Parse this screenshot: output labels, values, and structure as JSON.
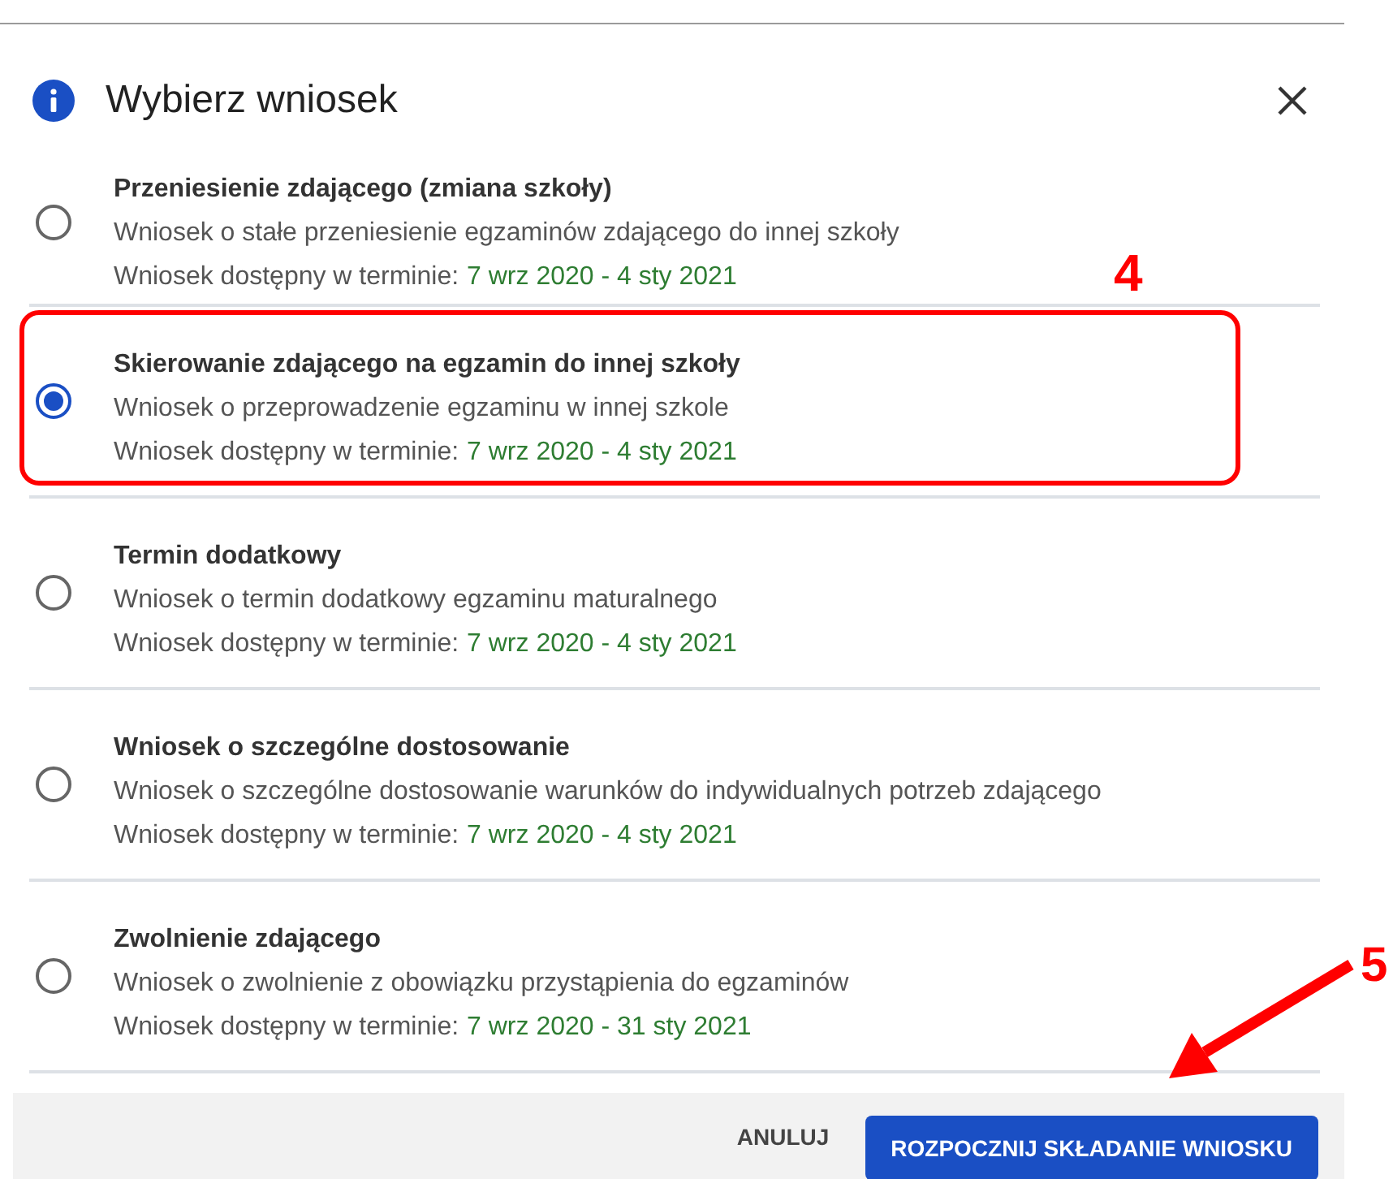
{
  "dialog": {
    "title": "Wybierz wniosek"
  },
  "options": [
    {
      "title": "Przeniesienie zdającego (zmiana szkoły)",
      "description": "Wniosek o stałe przeniesienie egzaminów zdającego do innej szkoły",
      "availability_label": "Wniosek dostępny w terminie:",
      "period": "7 wrz 2020 - 4 sty 2021",
      "selected": false,
      "highlighted": false
    },
    {
      "title": "Skierowanie zdającego na egzamin do innej szkoły",
      "description": "Wniosek o przeprowadzenie egzaminu w innej szkole",
      "availability_label": "Wniosek dostępny w terminie:",
      "period": "7 wrz 2020 - 4 sty 2021",
      "selected": true,
      "highlighted": true
    },
    {
      "title": "Termin dodatkowy",
      "description": "Wniosek o termin dodatkowy egzaminu maturalnego",
      "availability_label": "Wniosek dostępny w terminie:",
      "period": "7 wrz 2020 - 4 sty 2021",
      "selected": false,
      "highlighted": false
    },
    {
      "title": "Wniosek o szczególne dostosowanie",
      "description": "Wniosek o szczególne dostosowanie warunków do indywidualnych potrzeb zdającego",
      "availability_label": "Wniosek dostępny w terminie:",
      "period": "7 wrz 2020 - 4 sty 2021",
      "selected": false,
      "highlighted": false
    },
    {
      "title": "Zwolnienie zdającego",
      "description": "Wniosek o zwolnienie z obowiązku przystąpienia do egzaminów",
      "availability_label": "Wniosek dostępny w terminie:",
      "period": "7 wrz 2020 - 31 sty 2021",
      "selected": false,
      "highlighted": false
    }
  ],
  "buttons": [
    {
      "label": "ANULUJ",
      "kind": "text"
    },
    {
      "label": "ROZPOCZNIJ SKŁADANIE WNIOSKU",
      "kind": "primary"
    }
  ],
  "annotations": [
    {
      "label": "4",
      "kind": "number"
    },
    {
      "label": "5",
      "kind": "number_with_arrow"
    }
  ]
}
